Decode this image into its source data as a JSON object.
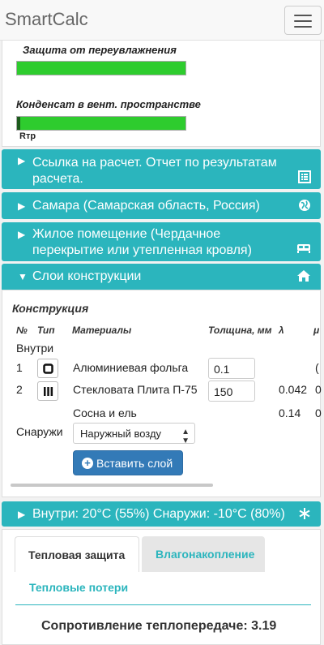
{
  "app": {
    "title": "SmartCalc"
  },
  "moisture": {
    "protection_label": "Защита от переувлажнения",
    "protection_level_percent": 100,
    "condensate_label": "Конденсат в вент. пространстве",
    "condensate_level_percent": 100,
    "rtp_label": "Rтр"
  },
  "accordion": {
    "report_link": "Ссылка на расчет. Отчет по результатам расчета.",
    "location": "Самара (Самарская область, Россия)",
    "room_type": "Жилое помещение (Чердачное перекрытие или утепленная кровля)",
    "layers": "Слои конструкции",
    "climate": "Внутри: 20°C (55%) Снаружи: -10°C (80%)"
  },
  "construction": {
    "title": "Конструкция",
    "headers": {
      "num": "№",
      "type": "Тип",
      "material": "Материалы",
      "thickness": "Толщина, мм",
      "lambda": "λ",
      "mu": "μ"
    },
    "inside_label": "Внутри",
    "rows": [
      {
        "num": "1",
        "type_icon": "square-icon",
        "material": "Алюминиевая фольга",
        "thickness": "0.1",
        "lambda": "",
        "mu": "("
      },
      {
        "num": "2",
        "type_icon": "bars-icon",
        "material": "Стекловата Плита П-75",
        "thickness": "150",
        "lambda": "0.042",
        "mu": "0"
      },
      {
        "num": "",
        "type_icon": "",
        "material": "Сосна и ель",
        "thickness": "",
        "lambda": "0.14",
        "mu": "0"
      }
    ],
    "outside_label": "Снаружи",
    "outside_select_value": "Наружный возду",
    "add_layer_button": "Вставить слой"
  },
  "results": {
    "tabs": [
      "Тепловая защита",
      "Влагонакопление"
    ],
    "active_tab": 0,
    "subtab": "Тепловые потери",
    "resistance_text": "Сопротивление теплопередаче: 3.19"
  },
  "colors": {
    "accent": "#2bb5bd",
    "bar": "#2ecc2e",
    "primary_button": "#337ab7"
  }
}
